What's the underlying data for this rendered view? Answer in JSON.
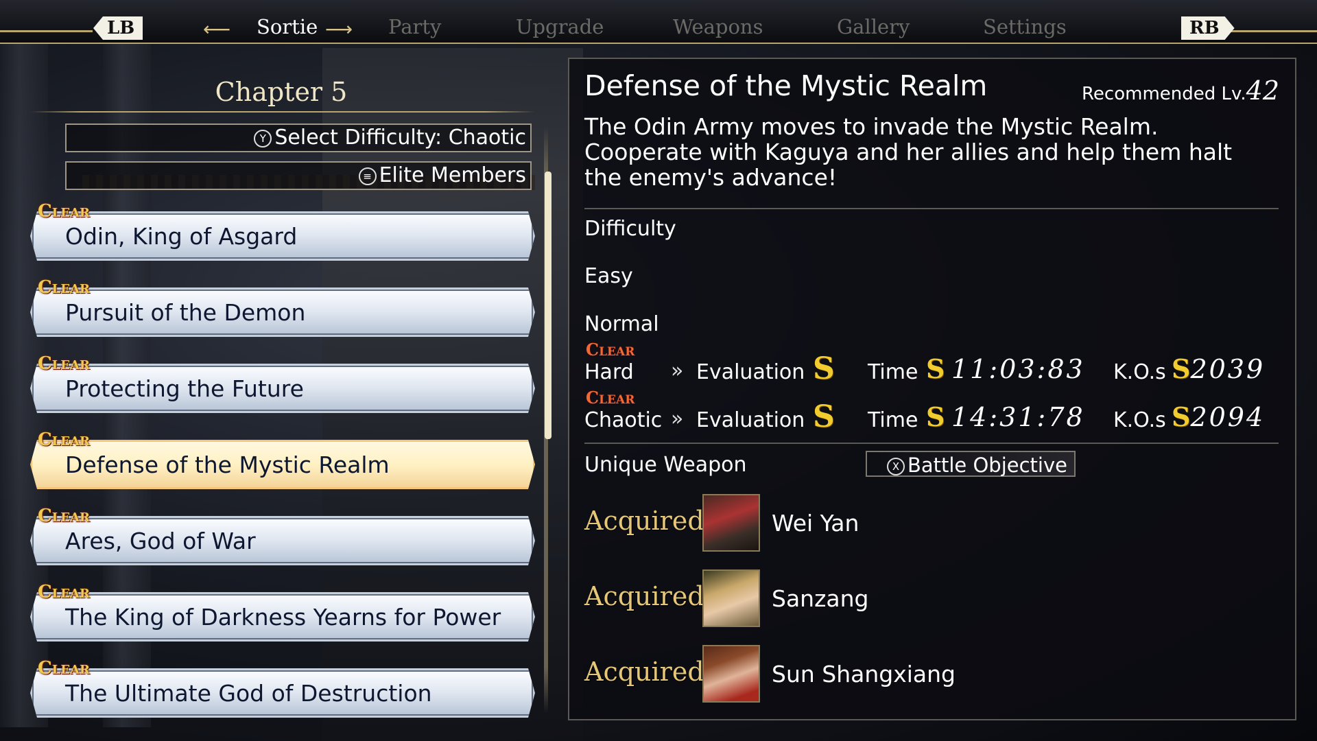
{
  "nav": {
    "lb": "LB",
    "rb": "RB",
    "tabs": [
      "Sortie",
      "Party",
      "Upgrade",
      "Weapons",
      "Gallery",
      "Settings"
    ]
  },
  "chapter": {
    "title": "Chapter 5",
    "select_difficulty": "Select Difficulty: Chaotic",
    "select_difficulty_icon": "Y",
    "elite_members": "Elite Members",
    "elite_icon": "≡",
    "clear_tag": "Clear",
    "missions": [
      "Odin, King of Asgard",
      "Pursuit of the Demon",
      "Protecting the Future",
      "Defense of the Mystic Realm",
      "Ares, God of War",
      "The King of Darkness Yearns for Power",
      "The Ultimate God of Destruction"
    ]
  },
  "detail": {
    "title": "Defense of the Mystic Realm",
    "recommended_label": "Recommended Lv.",
    "recommended_level": "42",
    "description": "The Odin Army moves to invade the Mystic Realm. Cooperate with Kaguya and her allies and help them halt the enemy's advance!",
    "difficulty_heading": "Difficulty",
    "difficulties": [
      {
        "name": "Easy"
      },
      {
        "name": "Normal"
      },
      {
        "name": "Hard",
        "clear": "Clear",
        "evaluation_label": "Evaluation",
        "grade": "S",
        "time_label": "Time",
        "time_grade": "S",
        "time": "11:03:83",
        "kos_label": "K.O.s",
        "kos_grade": "S",
        "kos": "2039"
      },
      {
        "name": "Chaotic",
        "clear": "Clear",
        "evaluation_label": "Evaluation",
        "grade": "S",
        "time_label": "Time",
        "time_grade": "S",
        "time": "14:31:78",
        "kos_label": "K.O.s",
        "kos_grade": "S",
        "kos": "2094"
      }
    ],
    "unique_weapon_heading": "Unique Weapon",
    "battle_objective": "Battle Objective",
    "battle_objective_icon": "X",
    "weapons": [
      {
        "status": "Acquired",
        "name": "Wei Yan",
        "portrait": "wei-yan-portrait"
      },
      {
        "status": "Acquired",
        "name": "Sanzang",
        "portrait": "sanzang-portrait"
      },
      {
        "status": "Acquired",
        "name": "Sun Shangxiang",
        "portrait": "sun-shangxiang-portrait"
      }
    ]
  },
  "colors": {
    "accent_gold": "#b9a56e",
    "grade_gold": "#f2cc2e",
    "clear_orange": "#f06a36",
    "selected_glow": "#f0a245"
  }
}
